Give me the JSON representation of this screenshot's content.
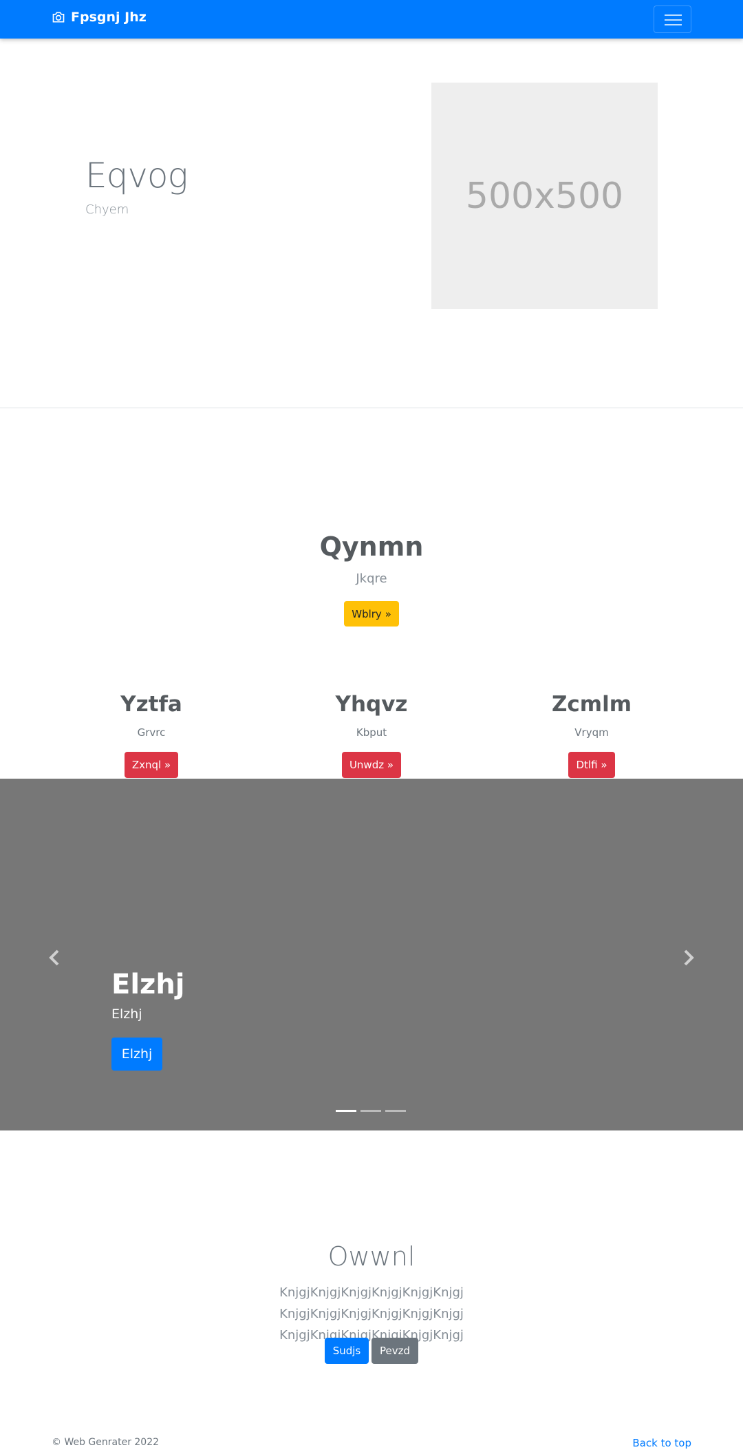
{
  "navbar": {
    "brand": "Fpsgnj Jhz",
    "brand_icon": "camera-icon",
    "toggler_icon": "hamburger-icon"
  },
  "hero": {
    "title": "Eqvog",
    "subtitle": "Chyem",
    "image_text": "500x500"
  },
  "feature": {
    "title": "Qynmn",
    "subtitle": "Jkqre",
    "button": "Wblry »"
  },
  "columns": [
    {
      "title": "Yztfa",
      "subtitle": "Grvrc",
      "button": "Zxnql »"
    },
    {
      "title": "Yhqvz",
      "subtitle": "Kbput",
      "button": "Unwdz »"
    },
    {
      "title": "Zcmlm",
      "subtitle": "Vryqm",
      "button": "Dtlfi »"
    }
  ],
  "carousel": {
    "title": "Elzhj",
    "subtitle": "Elzhj",
    "button": "Elzhj",
    "indicator_count": 3,
    "active_index": 0
  },
  "bottom": {
    "title": "Owwnl",
    "text": "KnjgjKnjgjKnjgjKnjgjKnjgjKnjgj KnjgjKnjgjKnjgjKnjgjKnjgjKnjgj KnjgjKnjgjKnjgjKnjgjKnjgjKnjgj",
    "primary_button": "Sudjs",
    "secondary_button": "Pevzd"
  },
  "footer": {
    "copyright": "© Web Genrater 2022",
    "back_to_top": "Back to top"
  },
  "colors": {
    "primary": "#007bff",
    "warning": "#ffc107",
    "danger": "#dc3545",
    "secondary": "#6c757d",
    "carousel_bg": "#777777"
  }
}
